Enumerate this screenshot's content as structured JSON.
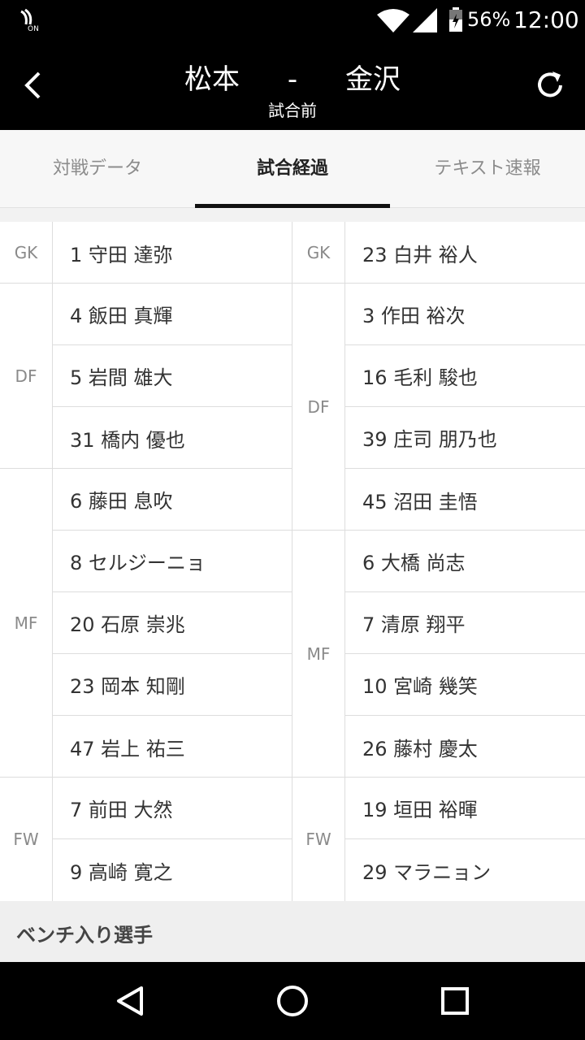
{
  "status_bar": {
    "battery": "56%",
    "time": "12:00",
    "icons": [
      "nfc-icon",
      "wifi-icon",
      "signal-icon",
      "battery-icon"
    ]
  },
  "header": {
    "home_team": "松本",
    "separator": "-",
    "away_team": "金沢",
    "status": "試合前"
  },
  "tabs": [
    {
      "label": "対戦データ",
      "active": false
    },
    {
      "label": "試合経過",
      "active": true
    },
    {
      "label": "テキスト速報",
      "active": false
    }
  ],
  "lineup": {
    "home": [
      {
        "pos": "GK",
        "players": [
          "1 守田 達弥"
        ]
      },
      {
        "pos": "DF",
        "players": [
          "4 飯田 真輝",
          "5 岩間 雄大",
          "31 橋内 優也"
        ]
      },
      {
        "pos": "MF",
        "players": [
          "6 藤田 息吹",
          "8 セルジーニョ",
          "20 石原 崇兆",
          "23 岡本 知剛",
          "47 岩上 祐三"
        ]
      },
      {
        "pos": "FW",
        "players": [
          "7 前田 大然",
          "9 高崎 寛之"
        ]
      }
    ],
    "away": [
      {
        "pos": "GK",
        "players": [
          "23 白井 裕人"
        ]
      },
      {
        "pos": "DF",
        "players": [
          "3 作田 裕次",
          "16 毛利 駿也",
          "39 庄司 朋乃也",
          "45 沼田 圭悟"
        ]
      },
      {
        "pos": "MF",
        "players": [
          "6 大橋 尚志",
          "7 清原 翔平",
          "10 宮崎 幾笑",
          "26 藤村 慶太"
        ]
      },
      {
        "pos": "FW",
        "players": [
          "19 垣田 裕暉",
          "29 マラニョン"
        ]
      }
    ]
  },
  "bench": {
    "label": "ベンチ入り選手"
  },
  "colors": {
    "header_bg": "#000000",
    "accent": "#111111",
    "inactive_tab": "#8c8c8c"
  }
}
